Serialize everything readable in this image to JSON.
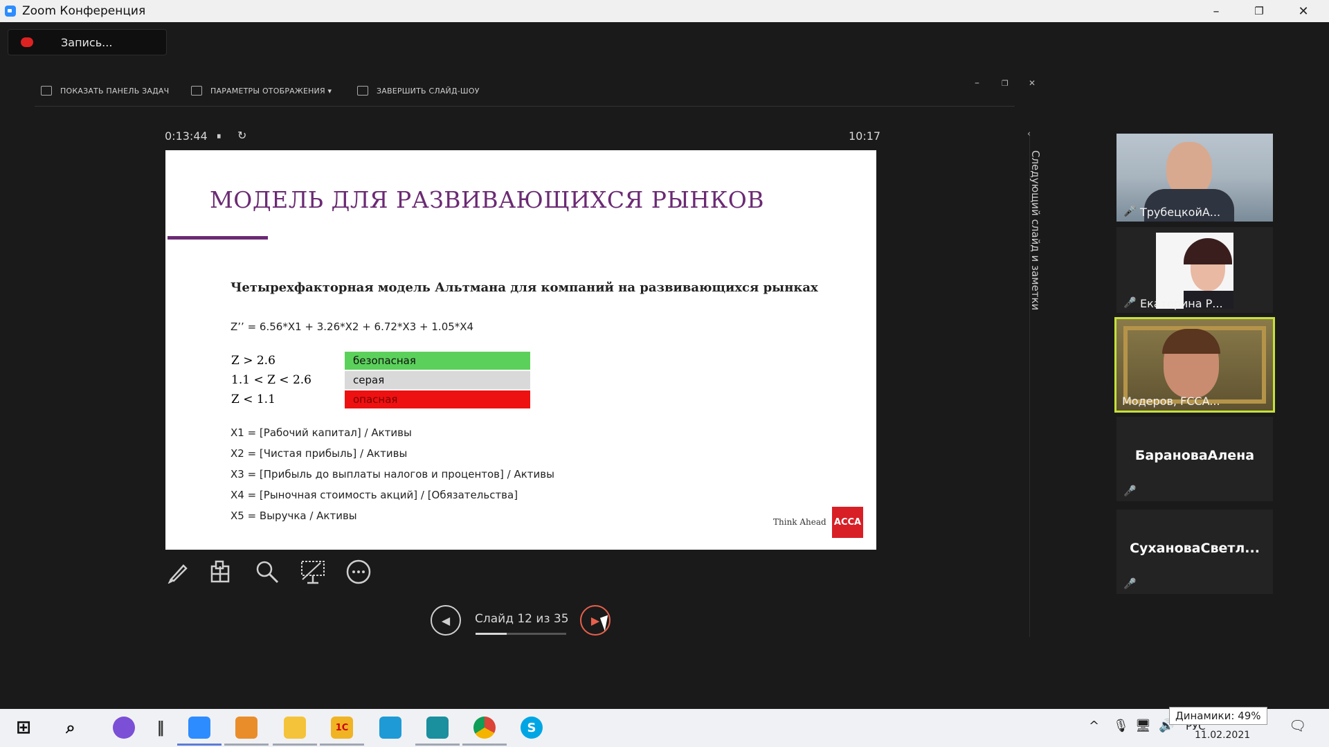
{
  "window": {
    "title": "Zoom Конференция",
    "minimize": "–",
    "restore": "❐",
    "close": "✕"
  },
  "recording": {
    "label": "Запись..."
  },
  "toolbar": {
    "show_taskbar": "ПОКАЗАТЬ ПАНЕЛЬ ЗАДАЧ",
    "display_settings": "ПАРАМЕТРЫ ОТОБРАЖЕНИЯ ▾",
    "end_slideshow": "ЗАВЕРШИТЬ СЛАЙД-ШОУ",
    "min": "–",
    "restore": "❐",
    "close": "✕"
  },
  "presenter": {
    "elapsed": "0:13:44",
    "pause_icon": "⏸",
    "reset_icon": "↻",
    "clock": "10:17",
    "notes_label": "Следующий слайд и заметки",
    "notes_chevron": "‹",
    "slide_counter": "Слайд 12 из 35",
    "progress": 0.343,
    "prev_icon": "◀",
    "next_icon": "▶",
    "tools": [
      "pen-icon",
      "grid-icon",
      "zoom-icon",
      "pointer-icon",
      "more-icon"
    ]
  },
  "slide": {
    "title": "МОДЕЛЬ ДЛЯ РАЗВИВАЮЩИХСЯ РЫНКОВ",
    "subtitle": "Четырехфакторная модель Альтмана для компаний на развивающихся рынках",
    "formula": "Z’’ = 6.56*X1 + 3.26*X2 + 6.72*X3 + 1.05*X4",
    "zones": [
      {
        "condition": "Z > 2.6",
        "label": "безопасная",
        "color": "#5bd15b"
      },
      {
        "condition": "1.1 < Z < 2.6",
        "label": "серая",
        "color": "#d9d9d9"
      },
      {
        "condition": "Z < 1.1",
        "label": "опасная",
        "color": "#ee1111"
      }
    ],
    "definitions": [
      "X1 = [Рабочий капитал] / Активы",
      "X2 = [Чистая прибыль] / Активы",
      "X3 = [Прибыль до выплаты налогов и процентов] / Активы",
      "X4 = [Рыночная стоимость акций] / [Обязательства]",
      "X5 = Выручка / Активы"
    ],
    "footer_tagline": "Think Ahead",
    "footer_logo": "ACCA"
  },
  "participants": [
    {
      "name": "ТрубецкойА...",
      "muted": true,
      "has_video": true,
      "active": false
    },
    {
      "name": "Екатерина Р...",
      "muted": true,
      "has_video": true,
      "active": false
    },
    {
      "name": "Модеров, FCCA...",
      "muted": false,
      "has_video": true,
      "active": true
    },
    {
      "name": "БарановаАлена",
      "muted": true,
      "has_video": false,
      "active": false
    },
    {
      "name": "СухановаСветл...",
      "muted": true,
      "has_video": false,
      "active": false
    }
  ],
  "taskbar": {
    "tray": {
      "lang": "РУС",
      "date": "11.02.2021",
      "volume_tooltip": "Динамики: 49%"
    },
    "apps": [
      "start-icon",
      "search-icon",
      "cortana-icon",
      "zoom-app-icon",
      "outlook-icon",
      "explorer-icon",
      "1c-icon",
      "ie-icon",
      "remote-icon",
      "chrome-icon",
      "skype-icon"
    ],
    "app_labels": {
      "onec": "1С",
      "skype": "S"
    }
  }
}
